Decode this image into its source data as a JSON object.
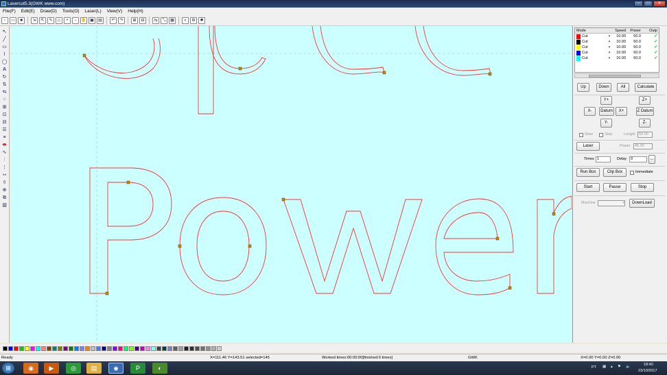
{
  "window": {
    "title": "Lasercut5.3(GWK www.com)"
  },
  "menu": [
    "File(F)",
    "Edit(E)",
    "Draw(D)",
    "Tools(O)",
    "Laser(L)",
    "View(V)",
    "Help(H)"
  ],
  "toolbar_icons": [
    "new-icon",
    "open-icon",
    "save-icon",
    "import-icon",
    "export-icon",
    "pen-icon",
    "node-icon",
    "zoom-in-icon",
    "zoom-out-icon",
    "pan-icon",
    "zoom-fit-icon",
    "zoom-page-icon",
    "undo-icon",
    "redo-icon",
    "group-icon",
    "ungroup-icon",
    "mirror-icon",
    "align-icon",
    "grid-icon",
    "preview-icon",
    "settings-icon",
    "laser-icon"
  ],
  "left_tools": [
    "select-icon",
    "line-icon",
    "rect-icon",
    "polyline-icon",
    "ellipse-icon",
    "text-icon",
    "rotate-icon",
    "mirror-h-icon",
    "mirror-v-icon",
    "node-edit-icon",
    "array-icon",
    "group-icon",
    "ungroup-icon",
    "align-left-icon",
    "align-center-icon",
    "combine-icon",
    "curve-icon",
    "distribute-icon",
    "distribute-v-icon",
    "space-h-icon",
    "space-v-icon",
    "size-icon",
    "layer-icon",
    "laser-path-icon"
  ],
  "canvas": {
    "bg_color": "#ccffff",
    "path_color": "#ff0000",
    "words": [
      "Speed",
      "Power"
    ]
  },
  "layers": {
    "headers": {
      "mode": "Mode",
      "speed": "Speed",
      "power": "Power",
      "output": "Outp"
    },
    "rows": [
      {
        "color": "#ff0000",
        "mode": "Cut",
        "speed": "10.00",
        "power": "60.0",
        "output": "✓"
      },
      {
        "color": "#000000",
        "mode": "Cut",
        "speed": "10.00",
        "power": "60.0",
        "output": "✓"
      },
      {
        "color": "#ffff00",
        "mode": "Cut",
        "speed": "10.00",
        "power": "60.0",
        "output": "✓"
      },
      {
        "color": "#0000ff",
        "mode": "Cut",
        "speed": "10.00",
        "power": "60.0",
        "output": "✓"
      },
      {
        "color": "#00ffff",
        "mode": "Cut",
        "speed": "10.00",
        "power": "60.0",
        "output": "✓"
      }
    ]
  },
  "panel": {
    "up": "Up",
    "down": "Down",
    "all": "All",
    "calculate": "Calculate",
    "y_plus": "Y+",
    "z_plus": "Z+",
    "x_minus": "X-",
    "datum": "Datum",
    "x_plus": "X+",
    "z_datum": "Z Datum",
    "y_minus": "Y-",
    "z_minus": "Z-",
    "slow": "Slow",
    "step": "Step",
    "length_label": "Length",
    "length_value": "50.00",
    "laser": "Laser",
    "power_label": "Power",
    "power_value": "45.00",
    "times_label": "Times",
    "times_value": "1",
    "delay_label": "Delay",
    "delay_value": "0",
    "delay_btn": "...",
    "run_box": "Run Box",
    "clip_box": "Clip Box",
    "immediate": "Immediate",
    "start": "Start",
    "pause": "Pause",
    "stop": "Stop",
    "machine_label": "Machine",
    "download": "DownLoad"
  },
  "palette": [
    "#000000",
    "#0000ff",
    "#ff0000",
    "#00cc00",
    "#ffff00",
    "#ff00ff",
    "#00ffff",
    "#ff8080",
    "#804000",
    "#008080",
    "#808000",
    "#800080",
    "#008000",
    "#0080ff",
    "#8080ff",
    "#ff8000",
    "#c0c0c0",
    "#4080ff",
    "#000080",
    "#808080",
    "#8000ff",
    "#ff0080",
    "#00ff80",
    "#80ff00",
    "#400080",
    "#c000c0",
    "#ff80ff",
    "#80ffff",
    "#404040",
    "#004040",
    "#8080c0",
    "#606060",
    "#a0a0a0",
    "#202020",
    "#303030",
    "#505050",
    "#707070",
    "#909090",
    "#b0b0b0",
    "#d0d0d0"
  ],
  "status": {
    "ready": "Ready",
    "coords": "X=111.46 Y=143.51 selected=145",
    "worked": "Worked times:00:00:00[finished:0 times]",
    "brand": "GWK",
    "origin": "X=0.00 Y=0.00 Z=0.00"
  },
  "taskbar": {
    "apps": [
      "start-orb-icon",
      "firefox-icon",
      "media-icon",
      "chrome-icon",
      "explorer-icon",
      "lasercut-icon",
      "pdf-icon",
      "app-icon"
    ],
    "lang": "PT",
    "time": "18:40",
    "date": "23/10/2017"
  }
}
